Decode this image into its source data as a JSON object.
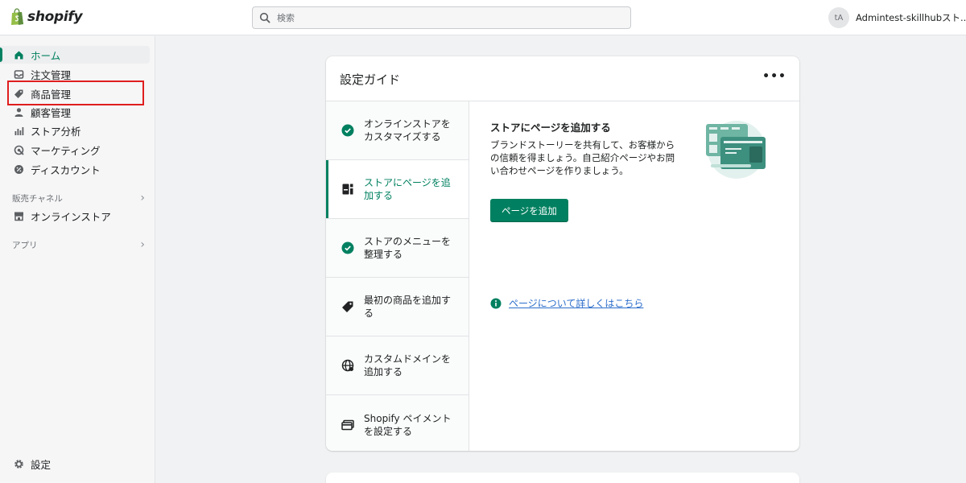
{
  "brand": {
    "name": "shopify",
    "color": "#008060"
  },
  "search": {
    "placeholder": "検索"
  },
  "account": {
    "initials": "tA",
    "name": "Admintest-skillhubスト..."
  },
  "sidebar": {
    "items": [
      {
        "label": "ホーム",
        "icon": "home-icon",
        "active": true
      },
      {
        "label": "注文管理",
        "icon": "inbox-icon"
      },
      {
        "label": "商品管理",
        "icon": "tag-icon"
      },
      {
        "label": "顧客管理",
        "icon": "person-icon"
      },
      {
        "label": "ストア分析",
        "icon": "bar-chart-icon"
      },
      {
        "label": "マーケティング",
        "icon": "target-icon"
      },
      {
        "label": "ディスカウント",
        "icon": "discount-icon"
      }
    ],
    "sales_channels": {
      "label": "販売チャネル",
      "item": "オンラインストア"
    },
    "apps": {
      "label": "アプリ"
    },
    "settings": {
      "label": "設定"
    }
  },
  "guide": {
    "title": "設定ガイド",
    "more": "•••",
    "steps": [
      {
        "label": "オンラインストアをカスタマイズする",
        "status": "done"
      },
      {
        "label": "ストアにページを追加する",
        "status": "active"
      },
      {
        "label": "ストアのメニューを整理する",
        "status": "done"
      },
      {
        "label": "最初の商品を追加する",
        "status": "todo"
      },
      {
        "label": "カスタムドメインを追加する",
        "status": "todo"
      },
      {
        "label": "Shopify ペイメントを設定する",
        "status": "todo"
      }
    ],
    "detail": {
      "title": "ストアにページを追加する",
      "description": "ブランドストーリーを共有して、お客様からの信頼を得ましょう。自己紹介ページやお問い合わせページを作りましょう。",
      "button": "ページを追加",
      "learn_more": "ページについて詳しくはこちら"
    }
  }
}
